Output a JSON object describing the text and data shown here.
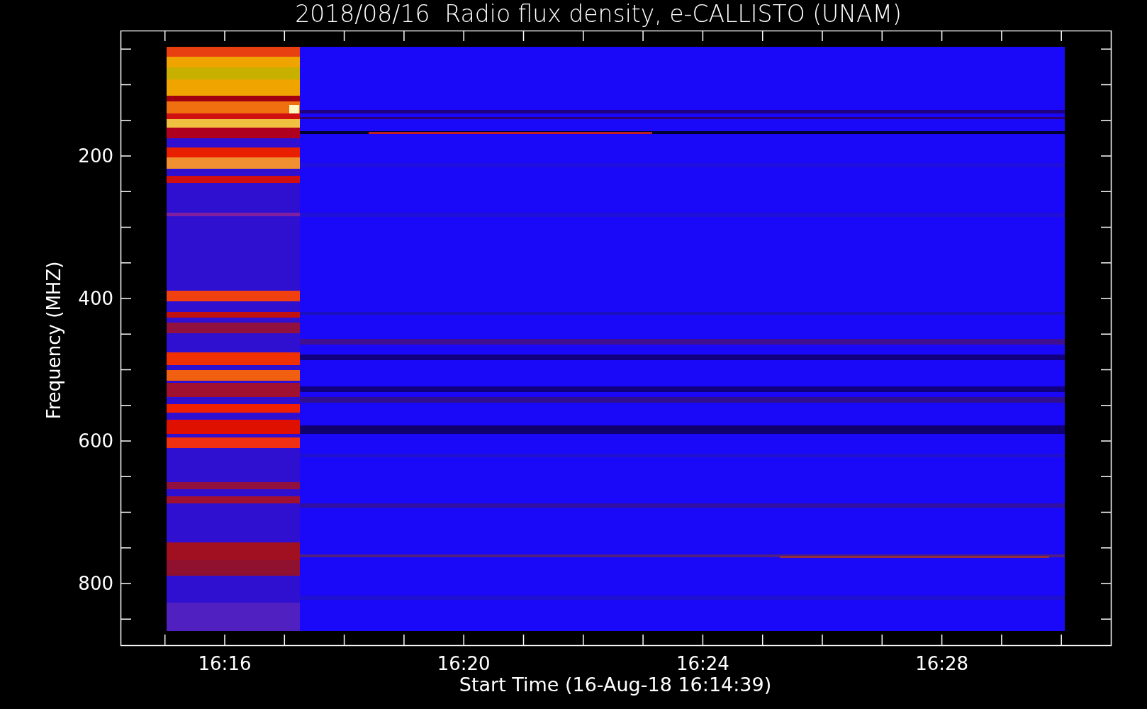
{
  "plot": {
    "title": "2018/08/16  Radio flux density, e-CALLISTO (UNAM)",
    "xlabel": "Start Time (16-Aug-18 16:14:39)",
    "ylabel": "Frequency (MHZ)",
    "xticks": [
      "16:16",
      "16:20",
      "16:24",
      "16:28"
    ],
    "yticks": [
      "200",
      "400",
      "600",
      "800"
    ]
  }
}
